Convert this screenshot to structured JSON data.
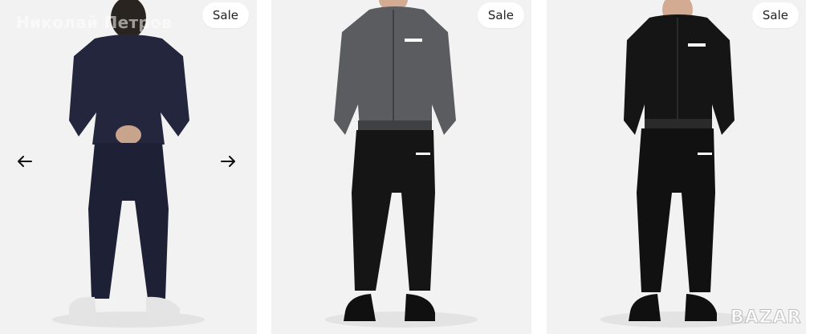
{
  "seller": {
    "name": "Николай Петров"
  },
  "cards": [
    {
      "badge": "Sale",
      "jacket_color": "#23263d",
      "pants_color": "#1e2136",
      "shoe_color": "#e4e4e4",
      "view": "back"
    },
    {
      "badge": "Sale",
      "jacket_color": "#5b5c60",
      "pants_color": "#151515",
      "shoe_color": "#101010",
      "view": "front"
    },
    {
      "badge": "Sale",
      "jacket_color": "#151515",
      "pants_color": "#111111",
      "shoe_color": "#101010",
      "view": "front"
    }
  ],
  "carousel": {
    "prev_icon": "arrow-left-icon",
    "next_icon": "arrow-right-icon"
  },
  "watermark": {
    "text": "BAZAR"
  },
  "colors": {
    "card_bg": "#f2f2f2",
    "badge_bg": "#ffffff",
    "badge_text": "#222222"
  }
}
